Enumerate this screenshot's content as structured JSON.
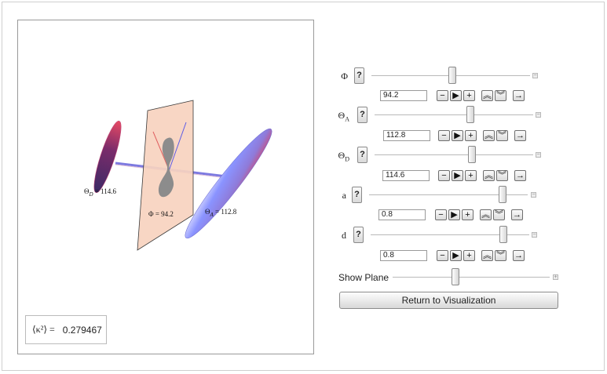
{
  "plot": {
    "phi_label": "Φ = 94.2",
    "thetaA_label": "Θ",
    "thetaA_sub": "A",
    "thetaA_eq": " = 112.8",
    "thetaD_label": "Θ",
    "thetaD_sub": "D",
    "thetaD_eq": " = 114.6",
    "kappa_symbol": "⟨κ²⟩ =",
    "kappa_value": "0.279467"
  },
  "controls": {
    "phi": {
      "label": "Φ",
      "value": "94.2",
      "help": "?",
      "slider_fraction": 0.495
    },
    "thetaA": {
      "label": "Θ",
      "sub": "A",
      "value": "112.8",
      "help": "?",
      "slider_fraction": 0.627
    },
    "thetaD": {
      "label": "Θ",
      "sub": "D",
      "value": "114.6",
      "help": "?",
      "slider_fraction": 0.637
    },
    "a": {
      "label": "a",
      "value": "0.8",
      "help": "?",
      "slider_fraction": 0.8
    },
    "d": {
      "label": "d",
      "value": "0.8",
      "help": "?",
      "slider_fraction": 0.8
    },
    "show_plane": {
      "label": "Show Plane",
      "slider_fraction": 0.4
    },
    "buttons": {
      "minus": "−",
      "play": "▶",
      "plus": "+",
      "faster": "︽",
      "slower": "︾",
      "direction": "→"
    },
    "end_mark_minus": "−",
    "end_mark_plus": "+"
  },
  "return_button": "Return to Visualization",
  "colors": {
    "plane": "#f7d3bf",
    "ellipsoid_blue": "#7e8cf0",
    "ellipsoid_red": "#e34a60",
    "dark_ellipsoid": "#5d2f6b"
  }
}
